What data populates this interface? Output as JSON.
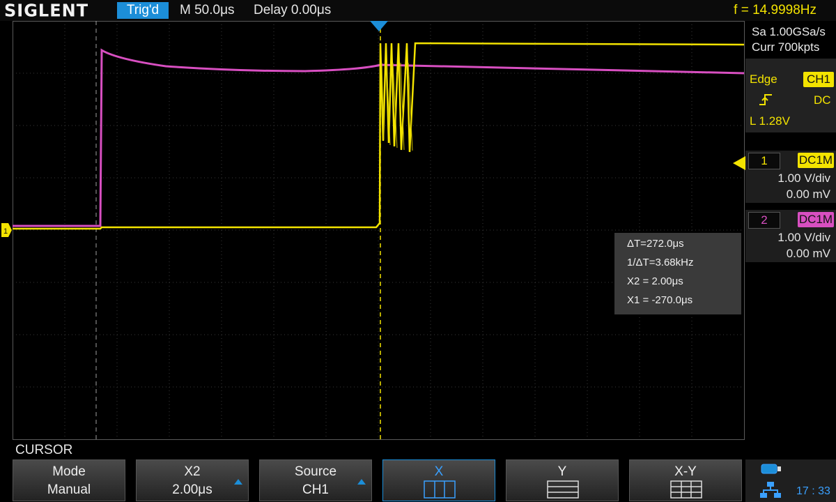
{
  "header": {
    "brand": "SIGLENT",
    "trigger_status": "Trig'd",
    "timebase": "M 50.0μs",
    "delay": "Delay 0.00μs",
    "frequency": "f = 14.9998Hz"
  },
  "acquisition": {
    "sample_rate": "Sa 1.00GSa/s",
    "memory": "Curr 700kpts"
  },
  "trigger": {
    "type": "Edge",
    "source": "CH1",
    "coupling": "DC",
    "level": "L  1.28V",
    "slope_icon": "rising-edge-icon"
  },
  "channels": [
    {
      "number": "1",
      "coupling": "DC1M",
      "scale": "1.00 V/div",
      "offset": "0.00 mV",
      "color": "#f3e300"
    },
    {
      "number": "2",
      "coupling": "DC1M",
      "scale": "1.00 V/div",
      "offset": "0.00 mV",
      "color": "#d84fc1"
    }
  ],
  "measurements": {
    "delta_t": "ΔT=272.0μs",
    "inv_delta_t": "1/ΔT=3.68kHz",
    "x2": "X2 = 2.00μs",
    "x1": "X1 = -270.0μs"
  },
  "menu": {
    "title": "CURSOR",
    "softkeys": [
      {
        "top": "Mode",
        "bottom": "Manual"
      },
      {
        "top": "X2",
        "bottom": "2.00μs"
      },
      {
        "top": "Source",
        "bottom": "CH1"
      },
      {
        "top": "X",
        "icon": "cursor-x-icon"
      },
      {
        "top": "Y",
        "icon": "cursor-y-icon"
      },
      {
        "top": "X-Y",
        "icon": "cursor-xy-icon"
      }
    ]
  },
  "status": {
    "time": "17 : 33",
    "icons": [
      "battery-icon",
      "network-icon"
    ]
  },
  "colors": {
    "ch1": "#f3e300",
    "ch2": "#d84fc1",
    "accent": "#1c8ed8"
  }
}
